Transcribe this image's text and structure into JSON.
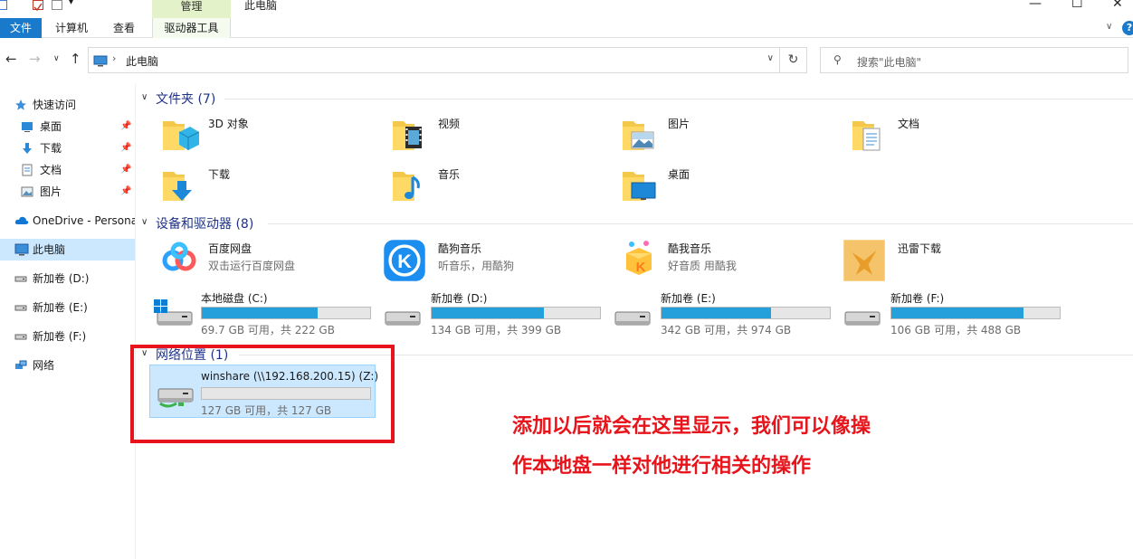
{
  "window": {
    "title": "此电脑",
    "manage_tab": "管理"
  },
  "ribbon": {
    "tabs": [
      "文件",
      "计算机",
      "查看"
    ],
    "drive_tools_tab": "驱动器工具",
    "help": "?"
  },
  "address": {
    "path": "此电脑",
    "search_placeholder": "搜索\"此电脑\""
  },
  "sidebar": {
    "items": [
      {
        "label": "快速访问",
        "icon": "star-icon"
      },
      {
        "label": "桌面",
        "icon": "desktop-icon",
        "pinned": true
      },
      {
        "label": "下载",
        "icon": "download-icon",
        "pinned": true
      },
      {
        "label": "文档",
        "icon": "document-icon",
        "pinned": true
      },
      {
        "label": "图片",
        "icon": "picture-icon",
        "pinned": true
      },
      {
        "label": "OneDrive - Persona",
        "icon": "cloud-icon"
      },
      {
        "label": "此电脑",
        "icon": "computer-icon",
        "selected": true
      },
      {
        "label": "新加卷 (D:)",
        "icon": "drive-icon"
      },
      {
        "label": "新加卷 (E:)",
        "icon": "drive-icon"
      },
      {
        "label": "新加卷 (F:)",
        "icon": "drive-icon"
      },
      {
        "label": "网络",
        "icon": "network-icon"
      }
    ]
  },
  "folders": {
    "header": "文件夹 (7)",
    "items": [
      {
        "label": "3D 对象",
        "icon": "3d-objects-folder-icon"
      },
      {
        "label": "视频",
        "icon": "videos-folder-icon"
      },
      {
        "label": "图片",
        "icon": "pictures-folder-icon"
      },
      {
        "label": "文档",
        "icon": "documents-folder-icon"
      },
      {
        "label": "下载",
        "icon": "downloads-folder-icon"
      },
      {
        "label": "音乐",
        "icon": "music-folder-icon"
      },
      {
        "label": "桌面",
        "icon": "desktop-folder-icon"
      }
    ]
  },
  "devices": {
    "header": "设备和驱动器 (8)",
    "apps": [
      {
        "label": "百度网盘",
        "sub": "双击运行百度网盘",
        "icon": "baidu-netdisk-icon"
      },
      {
        "label": "酷狗音乐",
        "sub": "听音乐，用酷狗",
        "icon": "kugou-music-icon"
      },
      {
        "label": "酷我音乐",
        "sub": "好音质 用酷我",
        "icon": "kuwo-music-icon"
      },
      {
        "label": "迅雷下载",
        "sub": "",
        "icon": "xunlei-download-icon"
      }
    ],
    "drives": [
      {
        "label": "本地磁盘 (C:)",
        "free": "69.7 GB 可用，共 222 GB",
        "used_fraction": 0.686,
        "icon": "windows-drive-icon"
      },
      {
        "label": "新加卷 (D:)",
        "free": "134 GB 可用，共 399 GB",
        "used_fraction": 0.664,
        "icon": "drive-icon"
      },
      {
        "label": "新加卷 (E:)",
        "free": "342 GB 可用，共 974 GB",
        "used_fraction": 0.649,
        "icon": "drive-icon"
      },
      {
        "label": "新加卷 (F:)",
        "free": "106 GB 可用，共 488 GB",
        "used_fraction": 0.783,
        "icon": "drive-icon"
      }
    ]
  },
  "network": {
    "header": "网络位置 (1)",
    "drive": {
      "label": "winshare (\\\\192.168.200.15) (Z:)",
      "free": "127 GB 可用，共 127 GB",
      "used_fraction": 0.0,
      "icon": "network-drive-icon"
    }
  },
  "annotation": {
    "line1": "添加以后就会在这里显示，我们可以像操",
    "line2": "作本地盘一样对他进行相关的操作"
  },
  "colors": {
    "accent": "#1979ca",
    "bar_fill": "#26a0da",
    "selection": "#cce8ff",
    "annotation_red": "#e8141b",
    "group_header": "#1e3287"
  }
}
